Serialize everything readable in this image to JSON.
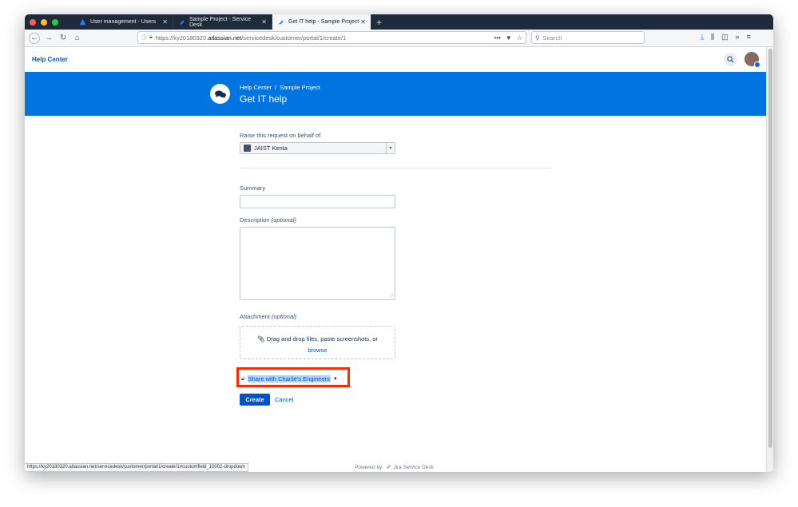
{
  "browser": {
    "tabs": [
      {
        "label": "User management - Users",
        "active": false
      },
      {
        "label": "Sample Project - Service Desk",
        "active": false
      },
      {
        "label": "Get IT help - Sample Project - S",
        "active": true
      }
    ],
    "url_prefix": "https://ky20180320.",
    "url_domain": "atlassian.net",
    "url_path": "/servicedesk/customer/portal/1/create/1",
    "search_placeholder": "Search",
    "status_url": "https://ky20180320.atlassian.net/servicedesk/customer/portal/1/create/1#customfield_10002-dropdown"
  },
  "header": {
    "title": "Help Center"
  },
  "banner": {
    "breadcrumb": [
      "Help Center",
      "Sample Project"
    ],
    "separator": "/",
    "title": "Get IT help"
  },
  "form": {
    "on_behalf_label": "Raise this request on behalf of",
    "on_behalf_value": "JAIST Kenta",
    "summary_label": "Summary",
    "summary_value": "",
    "description_label": "Description",
    "description_optional": "(optional)",
    "attachment_label": "Attachment",
    "attachment_optional": "(optional)",
    "attachment_text": "Drag and drop files, paste screenshots, or",
    "attachment_link": "browse",
    "share_label": "Share with Charlie's Engineers",
    "create_label": "Create",
    "cancel_label": "Cancel"
  },
  "footer": {
    "powered_by": "Powered by",
    "product": "Jira Service Desk"
  },
  "colors": {
    "banner": "#0074e0",
    "link": "#0052cc",
    "highlight": "#ff2a00"
  }
}
